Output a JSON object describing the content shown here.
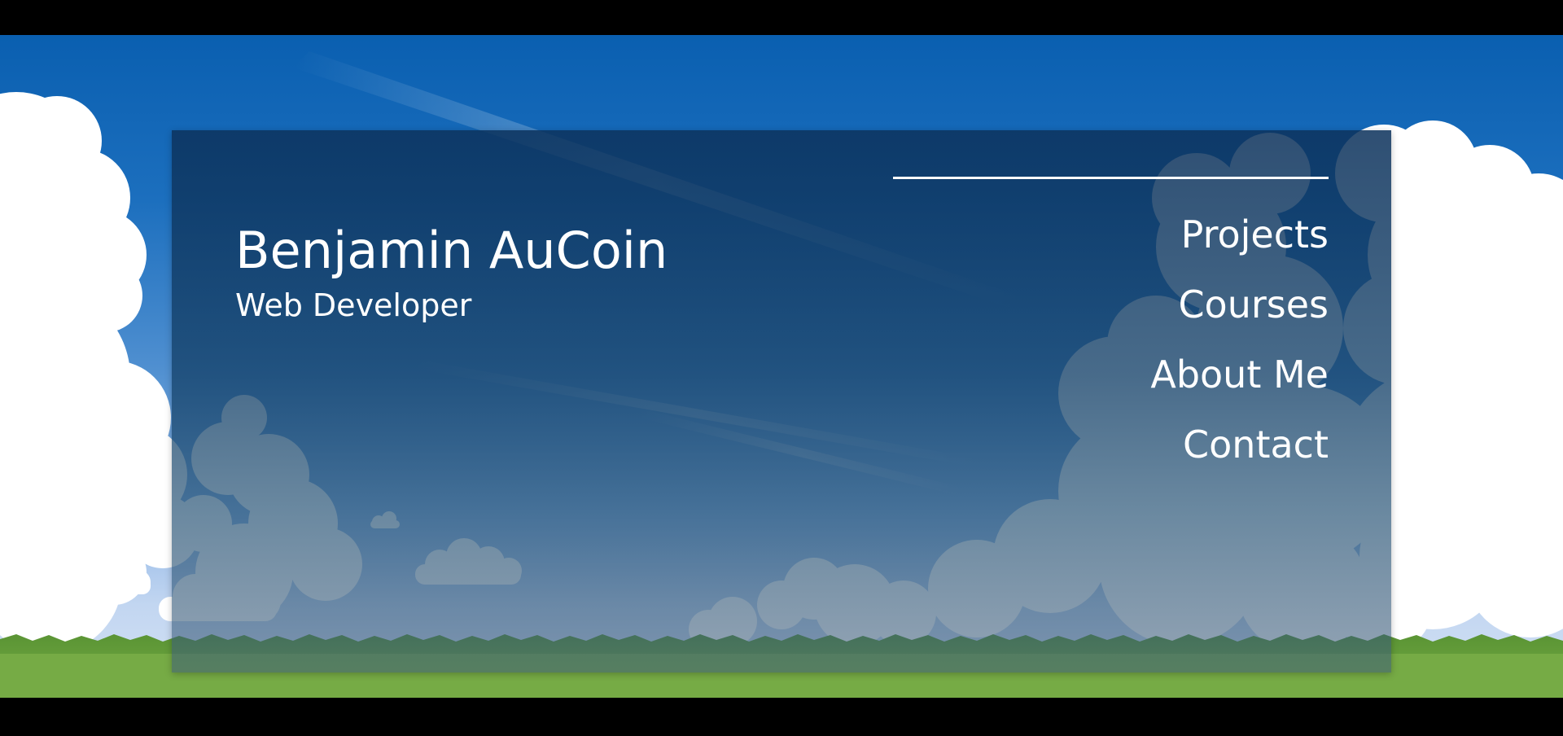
{
  "header": {
    "name": "Benjamin AuCoin",
    "subtitle": "Web Developer"
  },
  "nav": {
    "items": [
      {
        "label": "Projects"
      },
      {
        "label": "Courses"
      },
      {
        "label": "About Me"
      },
      {
        "label": "Contact"
      }
    ]
  },
  "colors": {
    "sky_top": "#0a5fb0",
    "sky_bottom": "#d6e3f4",
    "grass": "#6aa03c",
    "panel": "#0c325c",
    "text": "#ffffff"
  }
}
